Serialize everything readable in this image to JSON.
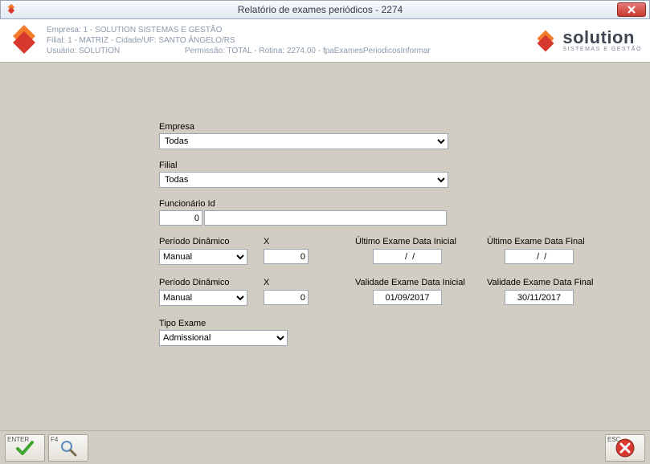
{
  "window": {
    "title": "Relatório de exames periódicos - 2274"
  },
  "header": {
    "empresa": "Empresa: 1 - SOLUTION SISTEMAS E GESTÃO",
    "filial": "Filial: 1 - MATRIZ - Cidade/UF: SANTO ÂNGELO/RS",
    "usuario": "Usuário: SOLUTION",
    "permissao": "Permissão: TOTAL - Rotina: 2274.00 - fpaExamesPeriodicosInformar",
    "brand_big": "solution",
    "brand_small": "SISTEMAS E GESTÃO"
  },
  "form": {
    "empresa": {
      "label": "Empresa",
      "value": "Todas"
    },
    "filial": {
      "label": "Filial",
      "value": "Todas"
    },
    "funcionario": {
      "label": "Funcionário Id",
      "id": "0",
      "name": ""
    },
    "period1": {
      "pd_label": "Período Dinâmico",
      "pd_value": "Manual",
      "x_label": "X",
      "x_value": "0",
      "d1_label": "Último Exame Data Inicial",
      "d1_value": "  /  /",
      "d2_label": "Último Exame Data Final",
      "d2_value": "  /  /"
    },
    "period2": {
      "pd_label": "Período Dinâmico",
      "pd_value": "Manual",
      "x_label": "X",
      "x_value": "0",
      "d1_label": "Validade Exame Data Inicial",
      "d1_value": "01/09/2017",
      "d2_label": "Validade Exame Data Final",
      "d2_value": "30/11/2017"
    },
    "tipo_exame": {
      "label": "Tipo Exame",
      "value": "Admissional"
    }
  },
  "footer": {
    "enter_key": "ENTER",
    "f4_key": "F4",
    "esc_key": "ESC"
  }
}
